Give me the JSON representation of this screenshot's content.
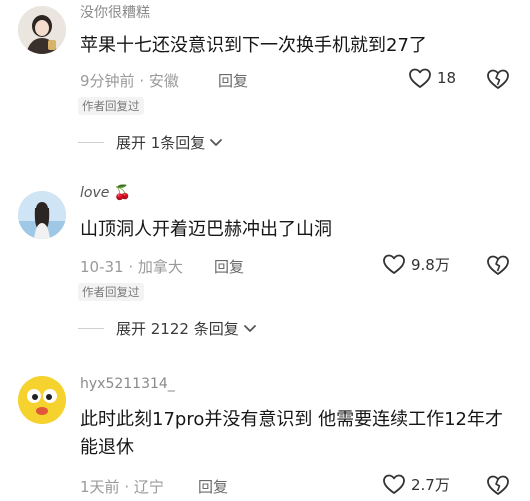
{
  "comments": [
    {
      "username": "没你很糟糕",
      "text": "苹果十七还没意识到下一次换手机就到27了",
      "time": "9分钟前",
      "location": "安徽",
      "reply_label": "回复",
      "likes": "18",
      "badge": "作者回复过",
      "expand_label": "展开 1条回复"
    },
    {
      "username": "love",
      "username_emoji": "🍒",
      "text": "山顶洞人开着迈巴赫冲出了山洞",
      "time": "10-31",
      "location": "加拿大",
      "reply_label": "回复",
      "likes": "9.8万",
      "badge": "作者回复过",
      "expand_label": "展开 2122 条回复"
    },
    {
      "username": "hyx5211314_",
      "text": "此时此刻17pro并没有意识到 他需要连续工作12年才能退休",
      "time": "1天前",
      "location": "辽宁",
      "reply_label": "回复",
      "likes": "2.7万"
    }
  ],
  "meta_separator": " · ",
  "icons": {
    "like": "heart-outline-icon",
    "dislike": "broken-heart-icon",
    "expand": "chevron-down-icon"
  }
}
